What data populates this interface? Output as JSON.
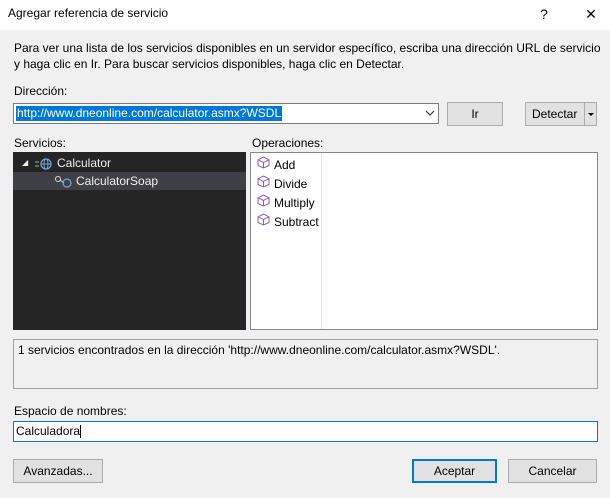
{
  "window": {
    "title": "Agregar referencia de servicio",
    "help_label": "?",
    "close_label": "✕"
  },
  "description": "Para ver una lista de los servicios disponibles en un servidor específico, escriba una dirección URL de servicio y haga clic en Ir. Para buscar servicios disponibles, haga clic en Detectar.",
  "address": {
    "label": "Dirección:",
    "value": "http://www.dneonline.com/calculator.asmx?WSDL",
    "go_button": "Ir",
    "discover_button": "Detectar"
  },
  "services": {
    "label": "Servicios:",
    "tree": [
      {
        "label": "Calculator",
        "icon": "web-service-icon",
        "expanded": true
      },
      {
        "label": "CalculatorSoap",
        "icon": "endpoint-icon"
      }
    ]
  },
  "operations": {
    "label": "Operaciones:",
    "items": [
      "Add",
      "Divide",
      "Multiply",
      "Subtract"
    ],
    "icon": "method-cube-icon"
  },
  "status_text": "1 servicios encontrados en la dirección 'http://www.dneonline.com/calculator.asmx?WSDL'.",
  "namespace": {
    "label": "Espacio de nombres:",
    "value": "Calculadora"
  },
  "buttons": {
    "advanced": "Avanzadas...",
    "accept": "Aceptar",
    "cancel": "Cancelar"
  },
  "colors": {
    "accent": "#0078d7",
    "tree_background": "#252526",
    "tree_selected": "#3f3f46"
  }
}
